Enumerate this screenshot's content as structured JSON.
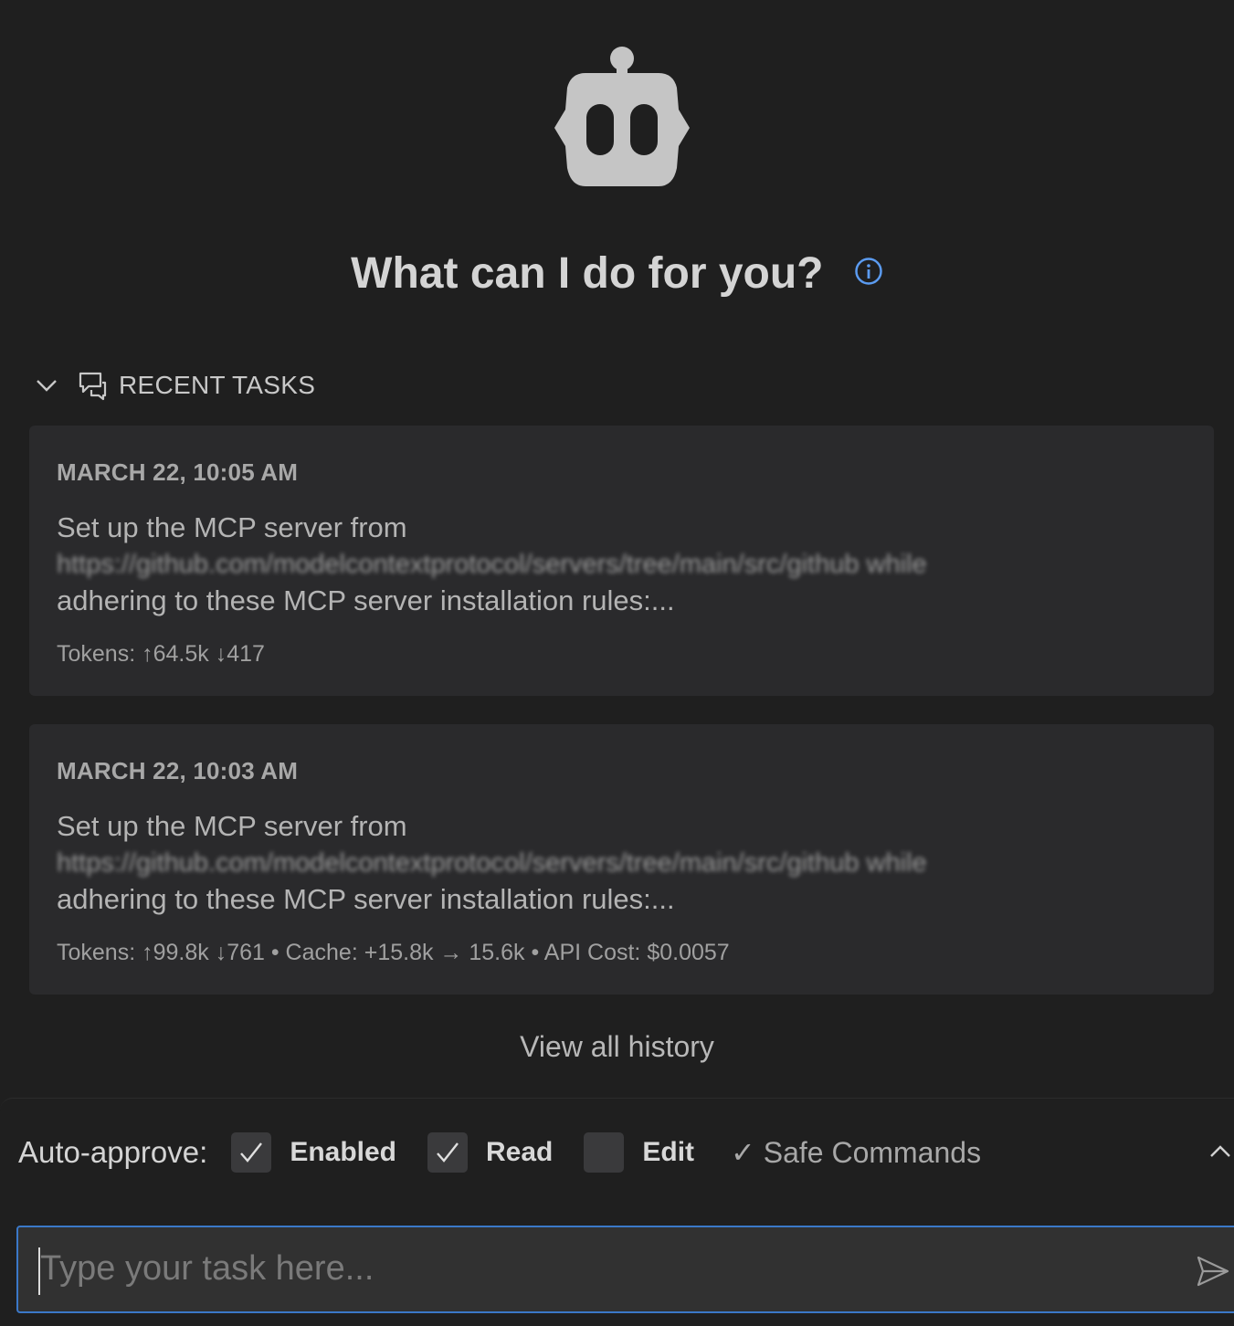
{
  "hero": {
    "title": "What can I do for you?"
  },
  "recent_tasks": {
    "header": "RECENT TASKS",
    "items": [
      {
        "date": "MARCH 22, 10:05 AM",
        "line1": "Set up the MCP server from",
        "line2": "https://github.com/modelcontextprotocol/servers/tree/main/src/github while",
        "line3": "adhering to these MCP server installation rules:...",
        "tokens": "Tokens: ↑64.5k ↓417"
      },
      {
        "date": "MARCH 22, 10:03 AM",
        "line1": "Set up the MCP server from",
        "line2": "https://github.com/modelcontextprotocol/servers/tree/main/src/github while",
        "line3": "adhering to these MCP server installation rules:...",
        "tokens": "Tokens: ↑99.8k ↓761 • Cache: +15.8k → 15.6k • API Cost: $0.0057"
      }
    ],
    "view_all": "View all history"
  },
  "auto_approve": {
    "label": "Auto-approve:",
    "options": [
      {
        "label": "Enabled",
        "checked": true
      },
      {
        "label": "Read",
        "checked": true
      },
      {
        "label": "Edit",
        "checked": false
      }
    ],
    "safe_commands": "✓ Safe Commands"
  },
  "input": {
    "placeholder": "Type your task here..."
  },
  "icons": {
    "robot": "robot-icon",
    "info": "info-icon",
    "chevron": "chevron-down-icon",
    "chat": "chat-bubbles-icon",
    "collapse": "chevron-up-icon",
    "send": "send-icon"
  },
  "colors": {
    "background": "#1f1f1f",
    "card": "#2a2a2c",
    "accent": "#3b78c8",
    "info": "#5b9bf0"
  }
}
